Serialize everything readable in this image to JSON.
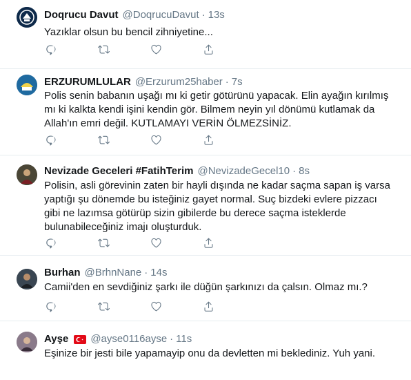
{
  "tweets": [
    {
      "name": "Doqrucu Davut",
      "handle": "@DoqrucuDavut",
      "time": "13s",
      "text": "Yazıklar olsun bu bencil zihniyetine..."
    },
    {
      "name": "ERZURUMLULAR",
      "handle": "@Erzurum25haber",
      "time": "7s",
      "lines": [
        "Polis senin babanın uşağı mı ki getir götürünü yapacak. Elin ayağın kırılmış",
        "mı ki kalkta kendi işini kendin gör. Bilmem neyin yıl dönümü kutlamak da",
        "Allah'ın emri değil. KUTLAMAYI VERİN ÖLMEZSİNİZ."
      ]
    },
    {
      "name": "Nevizade Geceleri #FatihTerim",
      "handle": "@NevizadeGecel10",
      "time": "8s",
      "lines": [
        "Polisin, asli görevinin zaten bir hayli dışında ne kadar saçma sapan iş varsa",
        "yaptığı şu dönemde bu isteğiniz gayet normal. Suç bizdeki evlere pizzacı",
        "gibi ne lazımsa götürüp sizin gibilerde bu derece saçma isteklerde",
        "bulunabileceğiniz imajı oluşturduk."
      ]
    },
    {
      "name": "Burhan",
      "handle": "@BrhnNane",
      "time": "14s",
      "text": "Camii'den en sevdiğiniz şarkı ile düğün şarkınızı da çalsın. Olmaz mı.?"
    },
    {
      "name": "Ayşe",
      "handle": "@ayse0116ayse",
      "time": "11s",
      "text": "Eşinize bir jesti bile yapamayip onu da devletten mi beklediniz. Yuh yani."
    }
  ],
  "separator": "·",
  "icons": {
    "reply": "reply-icon",
    "retweet": "retweet-icon",
    "like": "like-icon",
    "share": "share-icon",
    "flag": "turkey-flag-icon"
  },
  "colors": {
    "text": "#14171a",
    "secondary": "#657786",
    "divider": "#e6ecf0",
    "flag": "#e30a17"
  }
}
